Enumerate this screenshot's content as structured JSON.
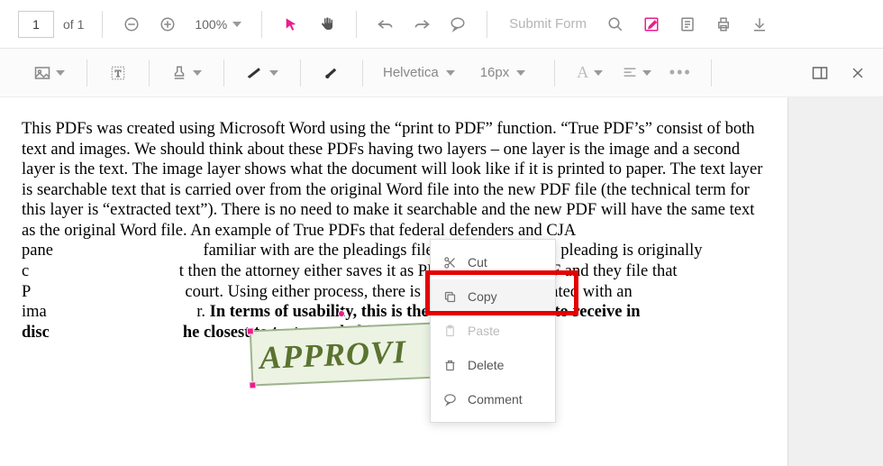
{
  "toolbar": {
    "page_current": "1",
    "page_label": "of 1",
    "zoom": "100%",
    "submit": "Submit Form"
  },
  "toolbar2": {
    "font": "Helvetica",
    "size": "16px"
  },
  "ctx": {
    "cut": "Cut",
    "copy": "Copy",
    "paste": "Paste",
    "delete": "Delete",
    "comment": "Comment"
  },
  "stamp": {
    "text": "APPROVI"
  },
  "doc": {
    "p1a": "This PDFs was created using Microsoft Word using the “print to PDF” function. “True PDF’s” consist of both text and images. We should think about these PDFs having two layers – one layer is the image and a second layer is the text. The image layer shows what the document will look like if it is printed to paper. The text layer is searchable text that is carried over from the original Word file into the new PDF file (the technical term for this layer is “extracted text”). There is no need to make it searchable and the new PDF will have the same text as the original Word file. An example of True PDFs that federal defenders and CJA pane",
    "p1b": "familiar with are the pleadings filed in CM/ECF. The pleading is originally c",
    "p1c": "t then the attorney either saves it as PDF or prints to PDF and they file that P",
    "p1d": " court. Using either process, there is now a PDF file created with an ima",
    "p1e": "r. ",
    "p1f": "In terms of usability, this is the best type of PDF to receive in disc",
    "p1g": "he closest to text searchability of the original file."
  }
}
